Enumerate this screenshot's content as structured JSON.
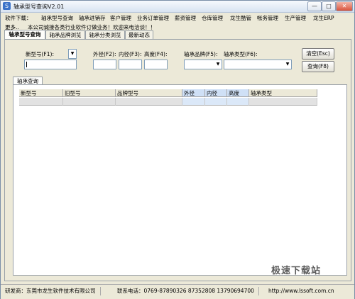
{
  "window": {
    "title": "轴承型号查询V2.01",
    "min_label": "—",
    "max_label": "□",
    "close_label": "✕"
  },
  "menu": [
    "软件下载：",
    "轴承型号查询",
    "轴承进销存",
    "客户管理",
    "业务订单管理",
    "薪资管理",
    "仓库管理",
    "龙生酷管",
    "帐务管理",
    "生产管理",
    "龙生ERP"
  ],
  "notice": {
    "more": "更多..",
    "text": "本公司诚接各类行业软件订做业务！欢迎来电洽谈！！"
  },
  "tabs": [
    "轴承型号查询",
    "轴承品牌浏览",
    "轴承分类浏览",
    "最新动态"
  ],
  "search": {
    "model_label": "新型号(F1):",
    "model_value": "",
    "outer_label": "外径(F2):",
    "inner_label": "内径(F3):",
    "height_label": "高度(F4):",
    "brand_label": "轴承品牌(F5):",
    "type_label": "轴承类型(F6):",
    "clear_button": "清空(Esc)",
    "query_button": "查询(F8)"
  },
  "results": {
    "tab_label": "轴承查询",
    "columns": [
      "新型号",
      "旧型号",
      "品牌型号",
      "外径",
      "内径",
      "高度",
      "轴承类型"
    ]
  },
  "status": {
    "developer": "研发商：东莞市龙生软件技术有限公司",
    "phone": "联系电话：0769-87890326 87352808 13790694700",
    "url": "http://www.lssoft.com.cn"
  },
  "watermark": "极速下载站"
}
